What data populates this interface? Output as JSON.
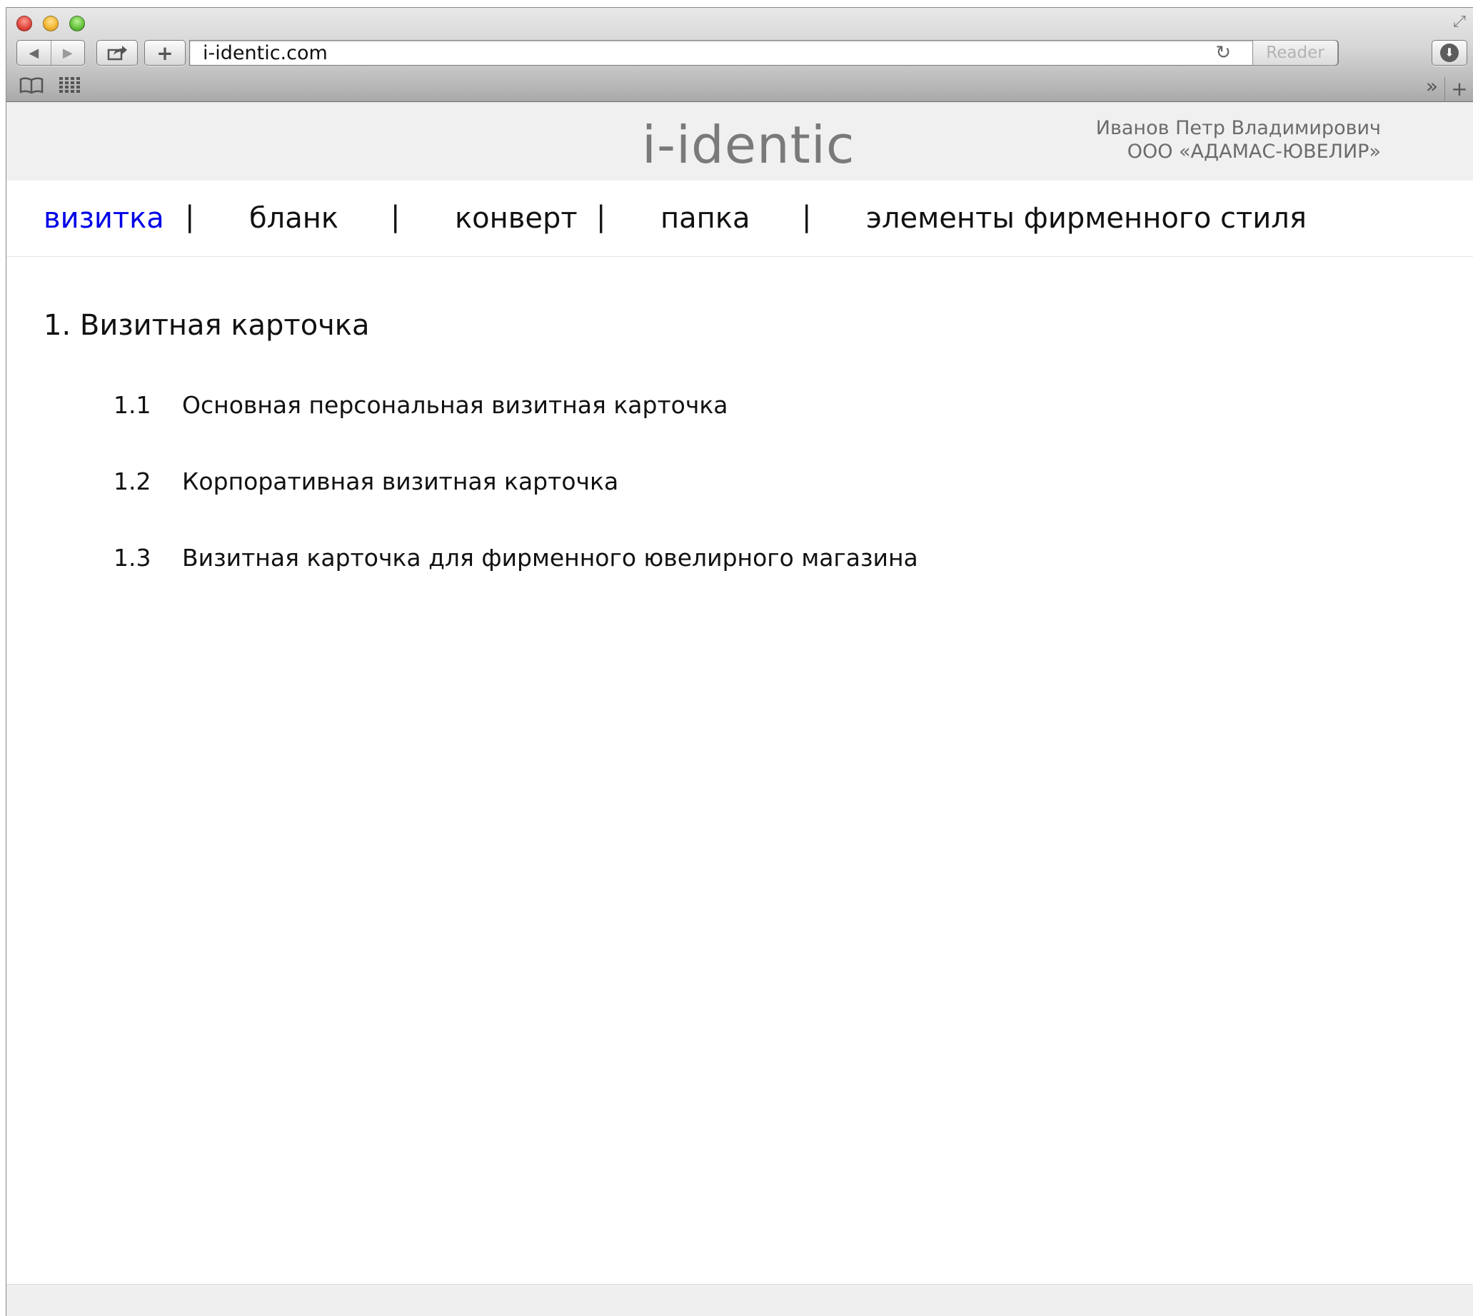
{
  "browser": {
    "url": "i-identic.com",
    "reader_label": "Reader",
    "icons": [
      "close-icon",
      "minimize-icon",
      "zoom-icon",
      "back-icon",
      "forward-icon",
      "share-icon",
      "add-icon",
      "reload-icon",
      "download-icon",
      "reading-list-icon",
      "top-sites-icon",
      "more-bookmarks-icon",
      "new-tab-icon",
      "fullscreen-icon"
    ]
  },
  "header": {
    "logo": "i-identic",
    "user_name": "Иванов Петр Владимирович",
    "company": "ООО «АДАМАС-ЮВЕЛИР»"
  },
  "nav": {
    "separator": "|",
    "items": [
      {
        "label": "визитка",
        "active": true
      },
      {
        "label": "бланк",
        "active": false
      },
      {
        "label": "конверт",
        "active": false
      },
      {
        "label": "папка",
        "active": false
      },
      {
        "label": "элементы фирменного стиля",
        "active": false
      }
    ]
  },
  "content": {
    "section_title": "1. Визитная карточка",
    "items": [
      {
        "num": "1.1",
        "label": "Основная персональная визитная карточка"
      },
      {
        "num": "1.2",
        "label": "Корпоративная визитная карточка"
      },
      {
        "num": "1.3",
        "label": "Визитная карточка для фирменного ювелирного магазина"
      }
    ]
  },
  "colors": {
    "active_link": "#0000e8",
    "header_bg": "#f0f0f0",
    "logo_text": "#7a7a7a"
  }
}
